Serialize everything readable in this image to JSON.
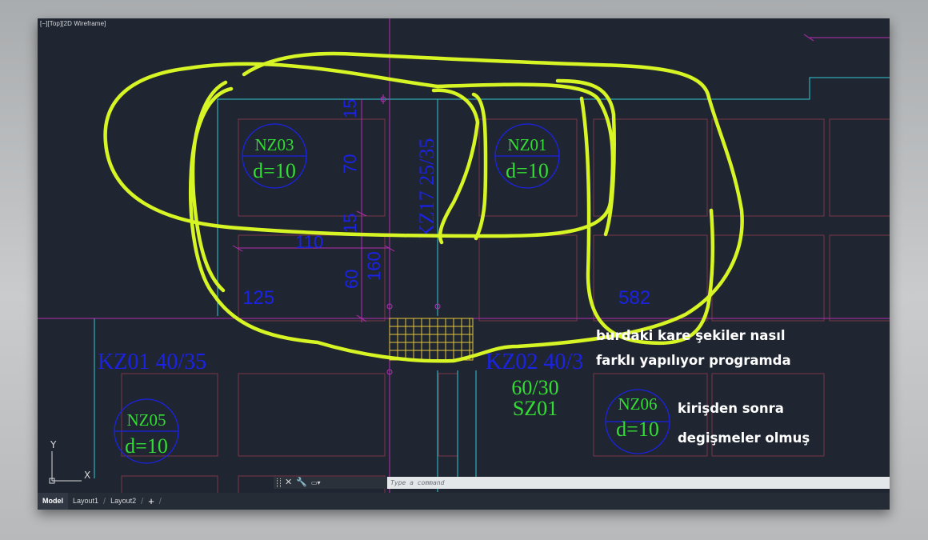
{
  "viewport": {
    "label": "[−][Top][2D Wireframe]"
  },
  "drawing": {
    "dimensions": [
      "15",
      "70",
      "15",
      "160",
      "60",
      "110",
      "125",
      "582"
    ],
    "beam_labels": [
      "KZ17 25/35",
      "KZ01 40/35",
      "KZ02 40/3"
    ],
    "slabs": [
      {
        "name": "NZ03",
        "thickness": "d=10"
      },
      {
        "name": "NZ01",
        "thickness": "d=10"
      },
      {
        "name": "NZ05",
        "thickness": "d=10"
      },
      {
        "name": "NZ06",
        "thickness": "d=10"
      }
    ],
    "column": {
      "size": "60/30",
      "name": "SZ01"
    }
  },
  "annotation": {
    "line1": "burdaki  kare şekiler nasıl",
    "line2": "farklı  yapılıyor programda",
    "line3": "kirişden sonra",
    "line4": "degişmeler  olmuş"
  },
  "ucs": {
    "x_label": "X",
    "y_label": "Y"
  },
  "command_line": {
    "placeholder": "Type a command"
  },
  "tabs": {
    "model": "Model",
    "layout1": "Layout1",
    "layout2": "Layout2",
    "add": "+"
  },
  "colors": {
    "background": "#202631",
    "dimension_blue": "#1a22e6",
    "slab_green": "#33dd33",
    "highlighter": "#d7f524",
    "beam_cyan": "#33c8d8",
    "axis_magenta": "#b22db2",
    "hatch_yellow": "#e3c63a",
    "outline_maroon": "#7a3548"
  }
}
